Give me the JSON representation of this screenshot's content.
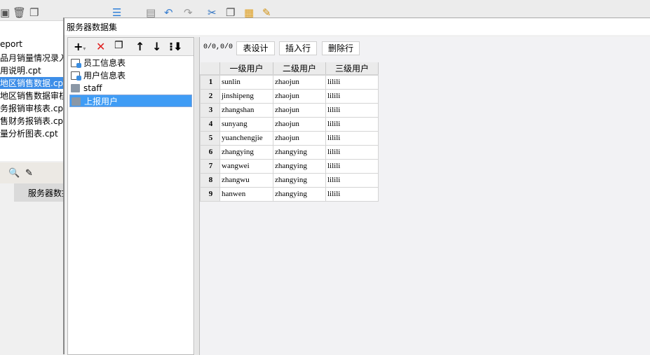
{
  "background": {
    "files": [
      {
        "label": "eport",
        "selected": false
      },
      {
        "label": "品月销量情况录入",
        "selected": false
      },
      {
        "label": "用说明.cpt",
        "selected": false
      },
      {
        "label": "地区销售数据.cpt",
        "selected": true
      },
      {
        "label": "地区销售数据审核",
        "selected": false
      },
      {
        "label": "务报销审核表.cpt",
        "selected": false
      },
      {
        "label": "售财务报销表.cpt",
        "selected": false
      },
      {
        "label": "量分析图表.cpt",
        "selected": false
      }
    ],
    "bottom_tab": "服务器数据集"
  },
  "dialog": {
    "title": "服务器数据集",
    "datasets": [
      {
        "label": "员工信息表",
        "icon": "table-doc-icon",
        "selected": false
      },
      {
        "label": "用户信息表",
        "icon": "table-doc-icon",
        "selected": false
      },
      {
        "label": "staff",
        "icon": "database-icon",
        "selected": false
      },
      {
        "label": "上报用户",
        "icon": "database-icon",
        "selected": true
      }
    ],
    "counter": "0/0,0/0",
    "buttons": {
      "design": "表设计",
      "insert": "插入行",
      "delete": "删除行"
    },
    "columns": [
      "一级用户",
      "二级用户",
      "三级用户"
    ],
    "rows": [
      [
        "1",
        "sunlin",
        "zhaojun",
        "lilili"
      ],
      [
        "2",
        "jinshipeng",
        "zhaojun",
        "lilili"
      ],
      [
        "3",
        "zhangshan",
        "zhaojun",
        "lilili"
      ],
      [
        "4",
        "sunyang",
        "zhaojun",
        "lilili"
      ],
      [
        "5",
        "yuanchengjie",
        "zhaojun",
        "lilili"
      ],
      [
        "6",
        "zhangying",
        "zhangying",
        "lilili"
      ],
      [
        "7",
        "wangwei",
        "zhangying",
        "lilili"
      ],
      [
        "8",
        "zhangwu",
        "zhangying",
        "lilili"
      ],
      [
        "9",
        "hanwen",
        "zhangying",
        "lilili"
      ]
    ]
  }
}
